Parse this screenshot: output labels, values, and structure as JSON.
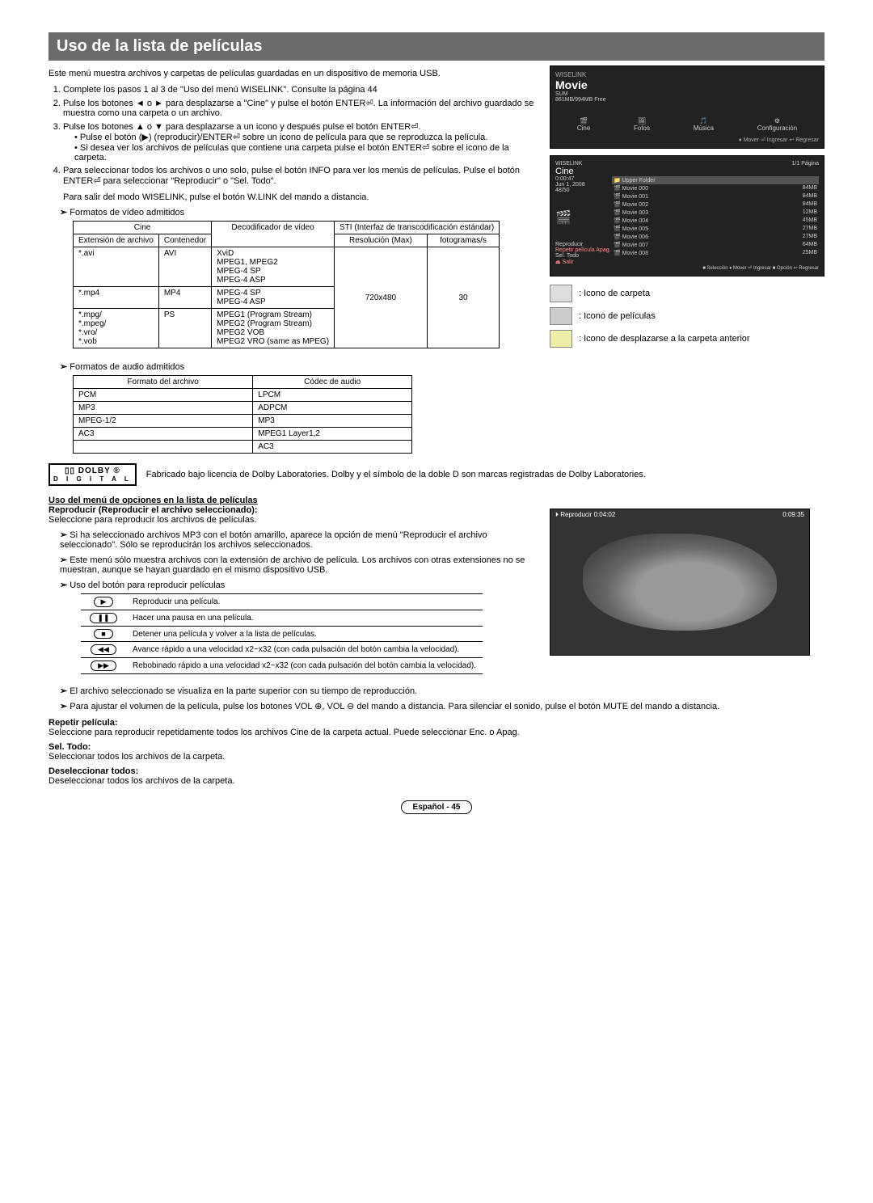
{
  "title": "Uso de la lista de películas",
  "intro": "Este menú muestra archivos y carpetas de películas guardadas en un dispositivo de memoria USB.",
  "steps": [
    {
      "text": "Complete los pasos 1 al 3 de \"Uso del menú WISELINK\". Consulte la página 44"
    },
    {
      "text": "Pulse los botones ◄ o ► para desplazarse a \"Cine\" y pulse el botón ENTER⏎. La información del archivo guardado se muestra como una carpeta o un archivo."
    },
    {
      "text": "Pulse los botones ▲ o ▼ para desplazarse a un icono y después pulse el botón ENTER⏎.",
      "bullets": [
        "Pulse el botón (▶) (reproducir)/ENTER⏎ sobre un icono de película para que se reproduzca la película.",
        "Si desea ver los archivos de películas que contiene una carpeta pulse el botón ENTER⏎ sobre el icono de la carpeta."
      ]
    },
    {
      "text": "Para seleccionar todos los archivos o uno solo, pulse el botón INFO para ver los menús de películas. Pulse el botón ENTER⏎ para seleccionar \"Reproducir\" o \"Sel. Todo\"."
    }
  ],
  "exit_note": "Para salir del modo WISELINK, pulse el botón W.LINK del mando a distancia.",
  "video_formats_heading": "Formatos de vídeo admitidos",
  "video_table": {
    "headers": {
      "ext_top": "Cine",
      "ext1": "Extensión de archivo",
      "ext2": "Contenedor",
      "dec": "Decodificador de vídeo",
      "sti_top": "STI (Interfaz de transcodificación estándar)",
      "res": "Resolución (Max)",
      "fps": "fotogramas/s"
    },
    "rows": [
      {
        "ext": "*.avi",
        "cont": "AVI",
        "dec": "XviD\nMPEG1, MPEG2\nMPEG-4 SP\nMPEG-4 ASP"
      },
      {
        "ext": "*.mp4",
        "cont": "MP4",
        "dec": "MPEG-4 SP\nMPEG-4 ASP"
      },
      {
        "ext": "*.mpg/\n*.mpeg/\n*.vro/\n*.vob",
        "cont": "PS",
        "dec": "MPEG1 (Program Stream)\nMPEG2 (Program Stream)\nMPEG2 VOB\nMPEG2 VRO (same as MPEG)"
      }
    ],
    "res": "720x480",
    "fps": "30"
  },
  "audio_formats_heading": "Formatos de audio admitidos",
  "audio_table": {
    "h1": "Formato del archivo",
    "h2": "Códec de audio",
    "rows": [
      {
        "a": "PCM",
        "b": "LPCM"
      },
      {
        "a": "MP3",
        "b": "ADPCM"
      },
      {
        "a": "MPEG-1/2",
        "b": "MP3"
      },
      {
        "a": "AC3",
        "b": "MPEG1 Layer1,2"
      },
      {
        "a": "",
        "b": "AC3"
      }
    ]
  },
  "dolby": "Fabricado bajo licencia de Dolby Laboratories. Dolby y el símbolo de la doble D son marcas registradas de Dolby Laboratories.",
  "dolby_brand": "DOLBY",
  "dolby_sub": "D I G I T A L",
  "options_heading": "Uso del menú de opciones en la lista de películas",
  "reproducir_h": "Reproducir (Reproducir el archivo seleccionado):",
  "reproducir_t": "Seleccione para reproducir los archivos de películas.",
  "rep_note1": "Si ha seleccionado archivos MP3 con el botón amarillo, aparece la opción de menú \"Reproducir el archivo seleccionado\". Sólo se reproducirán los archivos seleccionados.",
  "rep_note2": "Este menú sólo muestra archivos con la extensión de archivo de película. Los archivos con otras extensiones no se muestran, aunque se hayan guardado en el mismo dispositivo USB.",
  "play_btn_heading": "Uso del botón para reproducir películas",
  "play_table": [
    {
      "icon": "▶",
      "desc": "Reproducir una película."
    },
    {
      "icon": "❚❚",
      "desc": "Hacer una pausa en una película."
    },
    {
      "icon": "■",
      "desc": "Detener una película y volver a la lista de películas."
    },
    {
      "icon": "◀◀",
      "desc": "Avance rápido a una velocidad x2~x32 (con cada pulsación del botón cambia la velocidad)."
    },
    {
      "icon": "▶▶",
      "desc": "Rebobinado rápido a una velocidad x2~x32 (con cada pulsación del botón cambia la velocidad)."
    }
  ],
  "note_top": "El archivo seleccionado se visualiza en la parte superior con su tiempo de reproducción.",
  "note_vol": "Para ajustar el volumen de la película, pulse los botones VOL ⊕, VOL ⊖ del mando a distancia. Para silenciar el sonido, pulse el botón MUTE del mando a distancia.",
  "repetir_h": "Repetir película:",
  "repetir_t": "Seleccione para reproducir repetidamente todos los archivos Cine de la carpeta actual. Puede seleccionar Enc. o Apag.",
  "sel_h": "Sel. Todo:",
  "sel_t": "Seleccionar todos los archivos de la carpeta.",
  "des_h": "Deseleccionar todos:",
  "des_t": "Deseleccionar todos los archivos de la carpeta.",
  "footer": "Español - 45",
  "thumb1": {
    "wiselink": "WISELINK",
    "title": "Movie",
    "sub": "SUM\n861MB/994MB Free",
    "cats": [
      "Cine",
      "Fotos",
      "Música",
      "Configuración"
    ],
    "footer": "♦ Mover   ⏎ Ingresar   ↩ Regresar"
  },
  "thumb2": {
    "wiselink": "WISELINK",
    "title": "Cine",
    "device": "1/1 Página",
    "date": "Jun 1, 2008",
    "upper": "Upper Folder",
    "rows": [
      {
        "n": "Movie 000",
        "s": "84MB"
      },
      {
        "n": "Movie 001",
        "s": "84MB"
      },
      {
        "n": "Movie 002",
        "s": "84MB"
      },
      {
        "n": "Movie 003",
        "s": "12MB"
      },
      {
        "n": "Movie 004",
        "s": "45MB"
      },
      {
        "n": "Movie 005",
        "s": "27MB"
      },
      {
        "n": "Movie 006",
        "s": "27MB"
      },
      {
        "n": "Movie 007",
        "s": "64MB"
      },
      {
        "n": "Movie 008",
        "s": "25MB"
      }
    ],
    "side": [
      "Reproducir",
      "Repetir película   Apag.",
      "Sel. Todo"
    ],
    "footer": "■ Selección ♦ Mover ⏎ Ingresar ■ Opción ↩ Regresar"
  },
  "legend": {
    "folder": ": Icono de carpeta",
    "movie": ": Icono de películas",
    "back": ": Icono de desplazarse a la carpeta anterior"
  },
  "play_thumb": {
    "left": "⏵ Reproducir   0:04:02",
    "right": "0:09:35"
  }
}
